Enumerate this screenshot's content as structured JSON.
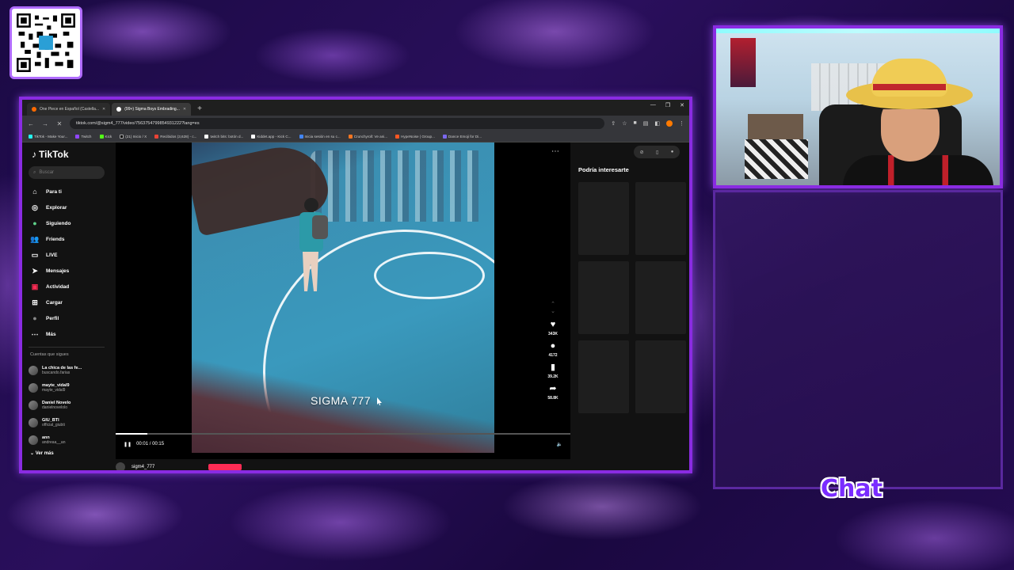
{
  "browser": {
    "tabs": [
      {
        "title": "One Piece en Español (Castella...",
        "active": false
      },
      {
        "title": "(99+) Sigma Boys Embrading...",
        "active": true
      }
    ],
    "url": "tiktok.com/@sigm4_777/video/7563754799854931222?lang=es",
    "bookmarks": [
      "TikTok - Make Your...",
      "Twitch",
      "Kick",
      "(21) Inicio / X",
      "Recibidos (3,628) - c...",
      "twitch bits: botón d...",
      "Kiddet.app - Kick C...",
      "Inicia sesión en su c...",
      "Crunchyroll: Ve ani...",
      "HypeNoise | Group...",
      "Dance Emoji for Di..."
    ]
  },
  "tiktok": {
    "logo": "TikTok",
    "search_placeholder": "Buscar",
    "nav": [
      {
        "label": "Para ti",
        "icon": "home-icon"
      },
      {
        "label": "Explorar",
        "icon": "compass-icon"
      },
      {
        "label": "Siguiendo",
        "icon": "following-icon"
      },
      {
        "label": "Friends",
        "icon": "friends-icon"
      },
      {
        "label": "LIVE",
        "icon": "live-icon"
      },
      {
        "label": "Mensajes",
        "icon": "send-icon"
      },
      {
        "label": "Actividad",
        "icon": "inbox-icon"
      },
      {
        "label": "Cargar",
        "icon": "upload-icon"
      },
      {
        "label": "Perfil",
        "icon": "profile-icon"
      },
      {
        "label": "Más",
        "icon": "more-icon"
      }
    ],
    "following_title": "Cuentas que sigues",
    "accounts": [
      {
        "name": "La chica de las fe...",
        "handle": "buscando.farias"
      },
      {
        "name": "mayte_vidal9",
        "handle": "mayte_vidal9"
      },
      {
        "name": "Daniel Novelo",
        "handle": "danielnovelolo"
      },
      {
        "name": "GIU_BTI",
        "handle": "official_giubti"
      },
      {
        "name": "ann",
        "handle": "andreaa__an"
      }
    ],
    "see_more": "Ver más",
    "video": {
      "caption": "SIGMA 777",
      "time": "00:01 / 00:15",
      "progress": 0.07
    },
    "actions": {
      "likes": "343K",
      "comments": "4172",
      "saves": "39.2K",
      "shares": "58.8K"
    },
    "recommend_title": "Podría interesarte",
    "creator_handle": "sigm4_777"
  },
  "overlay": {
    "chat_label": "Chat"
  }
}
